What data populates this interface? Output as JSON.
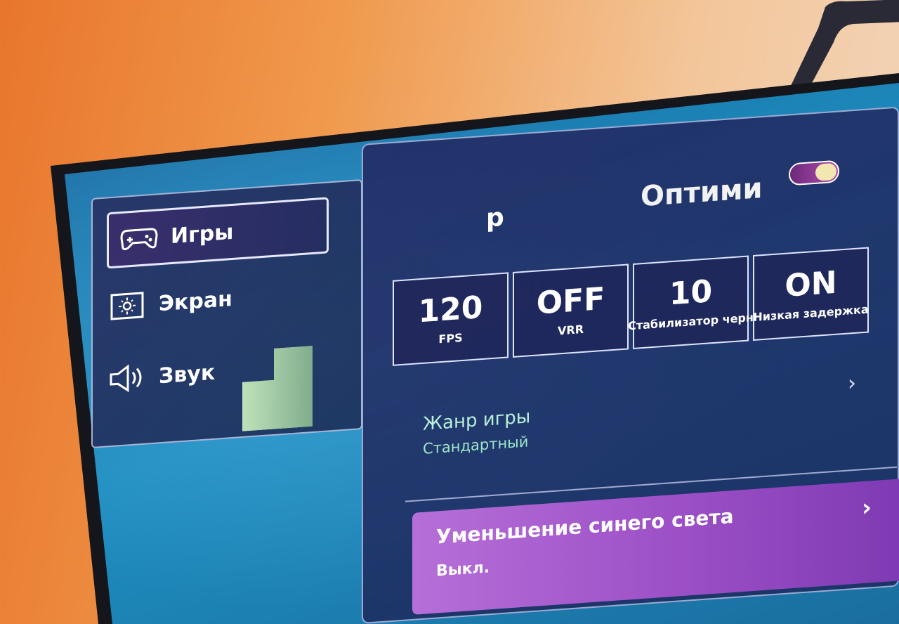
{
  "sidebar": {
    "items": [
      {
        "label": "Игры",
        "icon": "gamepad-icon",
        "active": true
      },
      {
        "label": "Экран",
        "icon": "brightness-icon",
        "active": false
      },
      {
        "label": "Звук",
        "icon": "speaker-icon",
        "active": false
      }
    ]
  },
  "header": {
    "title": "р",
    "optimizer_label": "Оптими",
    "toggle_state": "on"
  },
  "stats": [
    {
      "value": "120",
      "label": "FPS"
    },
    {
      "value": "OFF",
      "label": "VRR"
    },
    {
      "value": "10",
      "label": "Стабилизатор черн"
    },
    {
      "value": "ON",
      "label": "Низкая задержка"
    }
  ],
  "genre": {
    "title": "Жанр игры",
    "value": "Стандартный"
  },
  "blue_light": {
    "title": "Уменьшение синего света",
    "value": "Выкл."
  },
  "colors": {
    "accent_purple": "#a75acd",
    "panel_bg": "#23265f",
    "genre_text": "#b8f0d8"
  }
}
